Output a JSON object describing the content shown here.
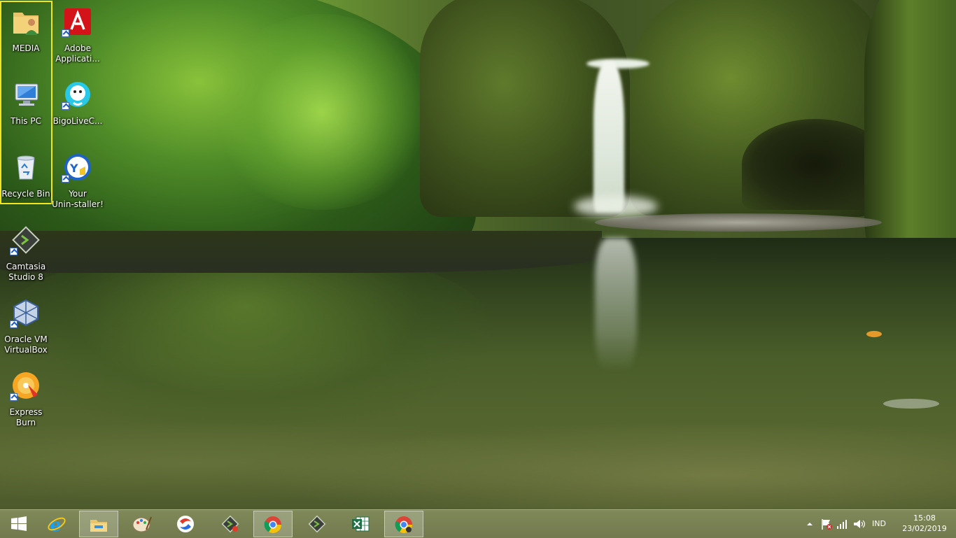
{
  "desktop": {
    "icons": [
      {
        "label": "MEDIA",
        "icon": "folder-user-icon"
      },
      {
        "label": "This PC",
        "icon": "computer-icon"
      },
      {
        "label": "Recycle Bin",
        "icon": "recycle-bin-icon"
      },
      {
        "label": "Adobe\nApplicati...",
        "icon": "adobe-icon"
      },
      {
        "label": "BigoLiveC...",
        "icon": "bigo-live-icon"
      },
      {
        "label": "Your\nUnin-staller!",
        "icon": "uninstaller-icon"
      },
      {
        "label": "Camtasia\nStudio 8",
        "icon": "camtasia-icon"
      },
      {
        "label": "Oracle VM\nVirtualBox",
        "icon": "virtualbox-icon"
      },
      {
        "label": "Express Burn",
        "icon": "express-burn-icon"
      }
    ],
    "selection_color": "#f0e51e"
  },
  "taskbar": {
    "items": [
      {
        "name": "start-button",
        "icon": "windows-logo-icon",
        "active": false
      },
      {
        "name": "internet-explorer",
        "icon": "internet-explorer-icon",
        "active": false
      },
      {
        "name": "file-explorer",
        "icon": "file-explorer-icon",
        "active": true
      },
      {
        "name": "paint",
        "icon": "paint-palette-icon",
        "active": false
      },
      {
        "name": "safari-like-browser",
        "icon": "browser-swirl-icon",
        "active": false
      },
      {
        "name": "camtasia-recorder",
        "icon": "camtasia-recorder-icon",
        "active": false
      },
      {
        "name": "chrome",
        "icon": "chrome-icon",
        "active": true
      },
      {
        "name": "camtasia",
        "icon": "camtasia-icon",
        "active": false
      },
      {
        "name": "excel",
        "icon": "excel-icon",
        "active": false
      },
      {
        "name": "chrome-2",
        "icon": "chrome-icon",
        "active": true
      }
    ],
    "tray": {
      "language": "IND",
      "time": "15:08",
      "date": "23/02/2019"
    }
  }
}
